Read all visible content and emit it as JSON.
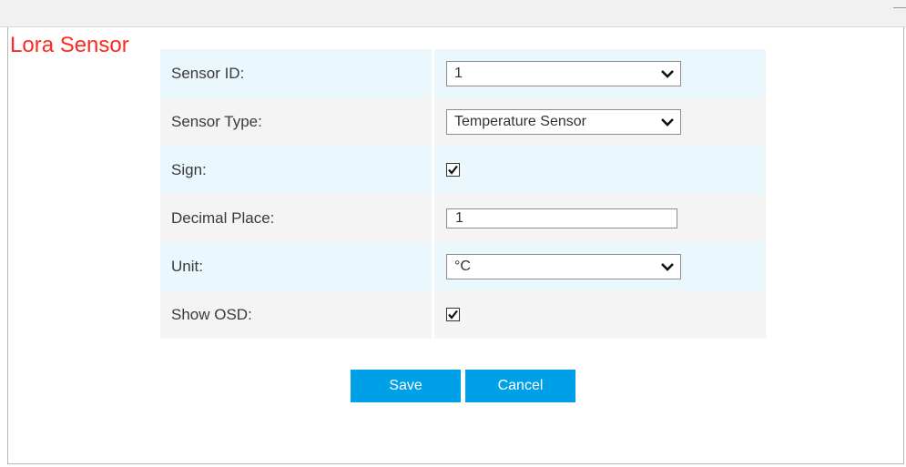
{
  "title": "Lora Sensor",
  "fields": {
    "sensor_id": {
      "label": "Sensor ID:",
      "value": "1"
    },
    "sensor_type": {
      "label": "Sensor Type:",
      "value": "Temperature Sensor"
    },
    "sign": {
      "label": "Sign:",
      "checked": true
    },
    "decimal_place": {
      "label": "Decimal Place:",
      "value": "1"
    },
    "unit": {
      "label": "Unit:",
      "value": "°C"
    },
    "show_osd": {
      "label": "Show OSD:",
      "checked": true
    }
  },
  "buttons": {
    "save": "Save",
    "cancel": "Cancel"
  },
  "colors": {
    "title": "#ff2a1f",
    "row_blue": "#eaf7fd",
    "row_grey": "#f4f4f4",
    "button": "#00a0e9"
  }
}
